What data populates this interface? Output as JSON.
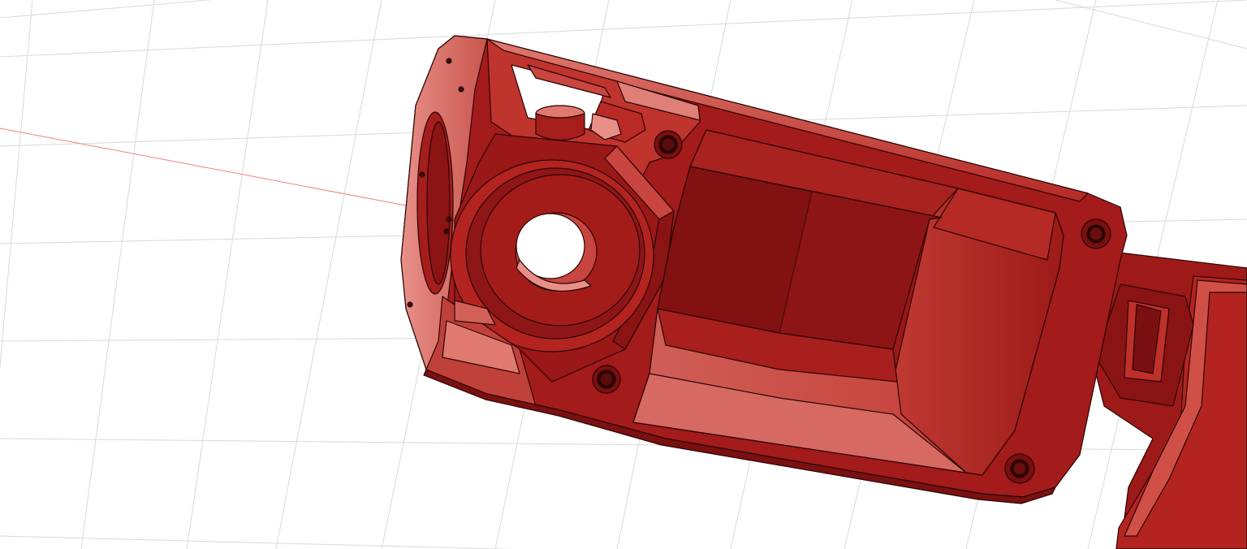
{
  "viewport": {
    "background_color": "#ffffff",
    "grid_color": "#d9d9d9",
    "axis_color": "#f08080",
    "model_colors": {
      "base": "#9a1717",
      "dark": "#6e0f0f",
      "mid": "#b01d1d",
      "light": "#d0554f",
      "highlight": "#e88a80",
      "edge": "#2a0505"
    }
  }
}
